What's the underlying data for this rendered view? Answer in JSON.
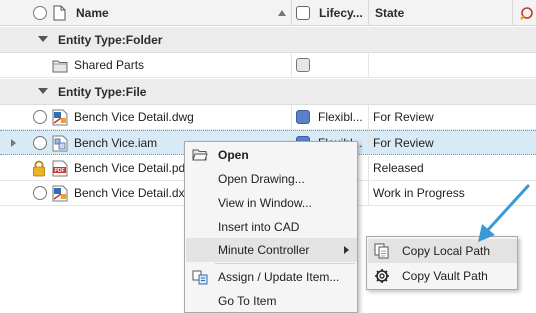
{
  "header": {
    "name": "Name",
    "lifecycle": "Lifecy...",
    "state": "State"
  },
  "groups": [
    {
      "label": "Entity Type:Folder"
    },
    {
      "label": "Entity Type:File"
    }
  ],
  "rows": [
    {
      "name": "Shared Parts",
      "lifecycle": "",
      "state": "",
      "icon": "folder-icon"
    },
    {
      "name": "Bench Vice Detail.dwg",
      "lifecycle": "Flexibl...",
      "state": "For Review",
      "icon": "dwg-file-icon"
    },
    {
      "name": "Bench Vice.iam",
      "lifecycle": "Flexibl...",
      "state": "For Review",
      "icon": "assembly-file-icon"
    },
    {
      "name": "Bench Vice Detail.pdf",
      "lifecycle": "",
      "state": "Released",
      "icon": "pdf-file-icon"
    },
    {
      "name": "Bench Vice Detail.dxf",
      "lifecycle": "",
      "state": "Work in Progress",
      "icon": "dxf-file-icon"
    }
  ],
  "context_menu": {
    "items": [
      {
        "label": "Open",
        "icon": "open-folder-icon"
      },
      {
        "label": "Open Drawing..."
      },
      {
        "label": "View in Window..."
      },
      {
        "label": "Insert into CAD"
      },
      {
        "label": "Minute Controller"
      },
      {
        "label": "Assign / Update Item...",
        "icon": "assign-item-icon"
      },
      {
        "label": "Go To Item"
      }
    ]
  },
  "submenu": {
    "items": [
      {
        "label": "Copy Local Path",
        "icon": "copy-path-icon"
      },
      {
        "label": "Copy Vault Path",
        "icon": "vault-gear-icon"
      }
    ]
  },
  "colors": {
    "selection": "#d9eaf7",
    "callout_arrow": "#3a9ad9",
    "checkbox_blue": "#5b80c9"
  }
}
